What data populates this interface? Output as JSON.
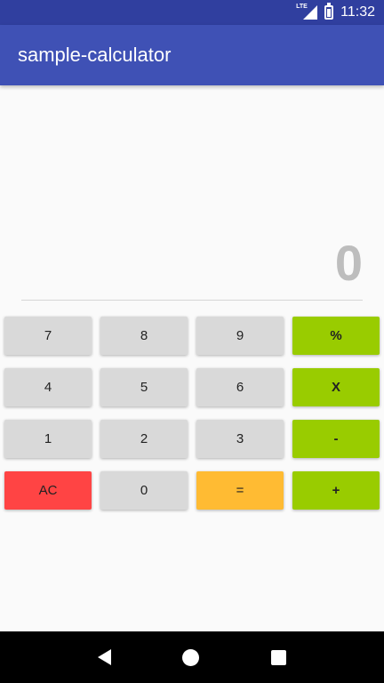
{
  "status_bar": {
    "time": "11:32",
    "network_label": "LTE",
    "icons": [
      "signal-icon",
      "battery-charging-icon"
    ]
  },
  "app_bar": {
    "title": "sample-calculator",
    "color": "#3f51b5"
  },
  "display": {
    "value": "0"
  },
  "keypad": {
    "rows": [
      [
        "7",
        "8",
        "9",
        "%"
      ],
      [
        "4",
        "5",
        "6",
        "X"
      ],
      [
        "1",
        "2",
        "3",
        "-"
      ],
      [
        "AC",
        "0",
        "=",
        "+"
      ]
    ],
    "colors": {
      "digit": "#d9d9d9",
      "operator": "#99cc00",
      "clear": "#ff4444",
      "equals": "#ffbb33"
    }
  },
  "nav_bar": {
    "icons": [
      "back-icon",
      "home-icon",
      "recent-apps-icon"
    ]
  }
}
